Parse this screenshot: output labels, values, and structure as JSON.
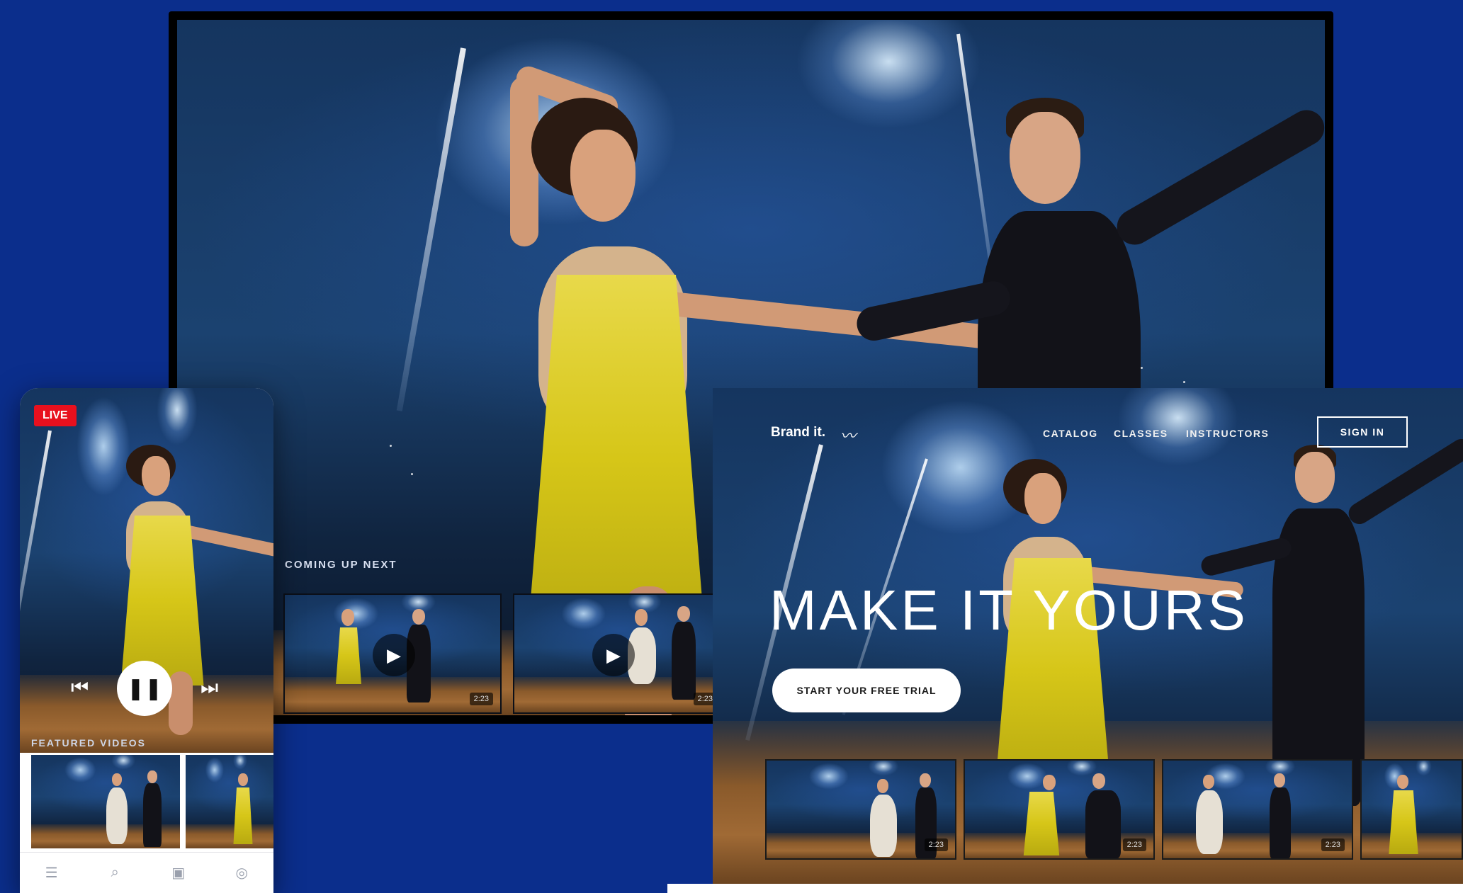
{
  "tv": {
    "coming_up_label": "COMING UP NEXT",
    "thumbs": [
      {
        "duration": "2:23"
      },
      {
        "duration": "2:23"
      }
    ]
  },
  "phone": {
    "live_label": "LIVE",
    "featured_label": "FEATURED VIDEOS",
    "controls": {
      "prev_icon": "skip-back-icon",
      "pause_icon": "pause-icon",
      "next_icon": "skip-forward-icon"
    },
    "tabs": [
      {
        "icon": "menu-icon",
        "glyph": "☰"
      },
      {
        "icon": "search-icon",
        "glyph": "⌕"
      },
      {
        "icon": "video-icon",
        "glyph": "▣"
      },
      {
        "icon": "settings-icon",
        "glyph": "◎"
      }
    ]
  },
  "web": {
    "brand": "Brand it.",
    "nav": [
      "CATALOG",
      "CLASSES",
      "INSTRUCTORS"
    ],
    "signin": "SIGN IN",
    "hero_title": "MAKE IT YOURS",
    "cta": "START YOUR FREE TRIAL",
    "thumbs": [
      {
        "duration": "2:23"
      },
      {
        "duration": "2:23"
      },
      {
        "duration": "2:23"
      },
      {
        "duration": ""
      }
    ]
  },
  "colors": {
    "background": "#0b2e8c",
    "live": "#e8101e",
    "dress": "#d6c618"
  }
}
